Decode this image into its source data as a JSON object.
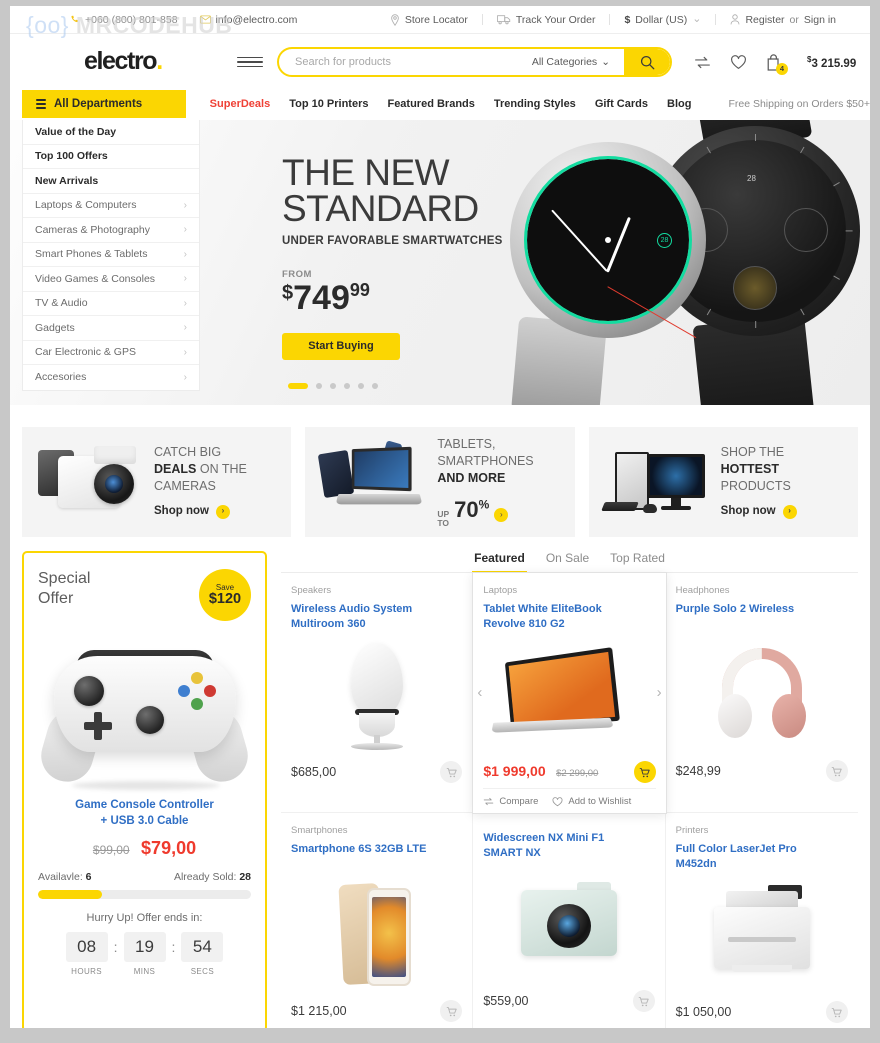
{
  "topbar": {
    "phone": "+060 (800) 801-858",
    "email": "info@electro.com",
    "store_locator": "Store Locator",
    "track_order": "Track Your Order",
    "currency": "Dollar (US)",
    "currency_symbol": "$",
    "register": "Register",
    "or": " or ",
    "signin": "Sign in"
  },
  "header": {
    "watermark_brace_open": "{",
    "watermark_oo": "oo",
    "watermark_brace_close": "}",
    "watermark_text": "MRCODEHUB",
    "logo": "electro",
    "logo_dot": ".",
    "cart_count": "4",
    "cart_total": "3 215.99",
    "cart_currency": "$"
  },
  "search": {
    "placeholder": "Search for products",
    "value": "",
    "category": "All Categories"
  },
  "nav": {
    "all_departments": "All Departments",
    "items": [
      {
        "label": "SuperDeals",
        "highlight": true
      },
      {
        "label": "Top 10 Printers",
        "highlight": false
      },
      {
        "label": "Featured Brands",
        "highlight": false
      },
      {
        "label": "Trending Styles",
        "highlight": false
      },
      {
        "label": "Gift Cards",
        "highlight": false
      },
      {
        "label": "Blog",
        "highlight": false
      }
    ],
    "shipping_note": "Free Shipping on Orders $50+"
  },
  "departments": [
    {
      "label": "Value of the Day",
      "bold": true,
      "arrow": false
    },
    {
      "label": "Top 100 Offers",
      "bold": true,
      "arrow": false
    },
    {
      "label": "New Arrivals",
      "bold": true,
      "arrow": false
    },
    {
      "label": "Laptops & Computers",
      "bold": false,
      "arrow": true
    },
    {
      "label": "Cameras & Photography",
      "bold": false,
      "arrow": true
    },
    {
      "label": "Smart Phones & Tablets",
      "bold": false,
      "arrow": true
    },
    {
      "label": "Video Games & Consoles",
      "bold": false,
      "arrow": true
    },
    {
      "label": "TV & Audio",
      "bold": false,
      "arrow": true
    },
    {
      "label": "Gadgets",
      "bold": false,
      "arrow": true
    },
    {
      "label": "Car Electronic & GPS",
      "bold": false,
      "arrow": true
    },
    {
      "label": "Accesories",
      "bold": false,
      "arrow": true
    }
  ],
  "hero": {
    "title_line1": "THE NEW",
    "title_line2": "STANDARD",
    "subtitle": "UNDER FAVORABLE SMARTWATCHES",
    "from_label": "FROM",
    "currency": "$",
    "price": "749",
    "cents": "99",
    "cta": "Start Buying",
    "watch_num_green": "28",
    "watch_num_dark": "28",
    "slide_count": 6,
    "active_slide": 1
  },
  "promos": [
    {
      "line1": "CATCH BIG",
      "line2_bold": "DEALS",
      "line2_rest": " ON THE",
      "line3": "CAMERAS",
      "cta": "Shop now",
      "art": "camera"
    },
    {
      "line1": "TABLETS,",
      "line2": "SMARTPHONES",
      "line3_bold": "AND MORE",
      "up_to_label1": "UP",
      "up_to_label2": "TO",
      "up_to_value": "70",
      "up_to_unit": "%",
      "art": "laptop-tablet"
    },
    {
      "line1": "SHOP THE",
      "line2_bold": "HOTTEST",
      "line3": "PRODUCTS",
      "cta": "Shop now",
      "art": "desktop"
    }
  ],
  "special_offer": {
    "title_line1": "Special",
    "title_line2": "Offer",
    "save_label": "Save",
    "save_amount": "$120",
    "product_name_line1": "Game Console Controller",
    "product_name_line2": "+ USB 3.0 Cable",
    "old_price": "$99,00",
    "new_price": "$79,00",
    "available_label": "Availavle:",
    "available_value": "6",
    "sold_label": "Already Sold:",
    "sold_value": "28",
    "progress_percent": 30,
    "hurry_text": "Hurry Up! Offer ends in:",
    "countdown": {
      "hours": "08",
      "hours_label": "HOURS",
      "mins": "19",
      "mins_label": "MINS",
      "secs": "54",
      "secs_label": "SECS",
      "separator": ":"
    }
  },
  "product_tabs": [
    {
      "label": "Featured",
      "active": true
    },
    {
      "label": "On Sale",
      "active": false
    },
    {
      "label": "Top Rated",
      "active": false
    }
  ],
  "products": [
    {
      "category": "Speakers",
      "name_line1": "Wireless Audio System",
      "name_line2": "Multiroom 360",
      "price": "$685,00",
      "old_price": "",
      "on_sale": false,
      "hovered": false,
      "art": "speaker"
    },
    {
      "category": "Laptops",
      "name_line1": "Tablet White EliteBook",
      "name_line2": "Revolve 810 G2",
      "price": "$1 999,00",
      "old_price": "$2 299,00",
      "on_sale": true,
      "hovered": true,
      "art": "laptop",
      "compare_label": "Compare",
      "wishlist_label": "Add to Wishlist"
    },
    {
      "category": "Headphones",
      "name_line1": "Purple Solo 2 Wireless",
      "name_line2": "",
      "price": "$248,99",
      "old_price": "",
      "on_sale": false,
      "hovered": false,
      "art": "headphones"
    },
    {
      "category": "Smartphones",
      "name_line1": "Smartphone 6S 32GB LTE",
      "name_line2": "",
      "price": "$1 215,00",
      "old_price": "",
      "on_sale": false,
      "hovered": false,
      "art": "phone"
    },
    {
      "category": "",
      "name_line1": "Widescreen NX Mini F1",
      "name_line2": "SMART NX",
      "price": "$559,00",
      "old_price": "",
      "on_sale": false,
      "hovered": false,
      "art": "compact-camera"
    },
    {
      "category": "Printers",
      "name_line1": "Full Color LaserJet Pro",
      "name_line2": "M452dn",
      "price": "$1 050,00",
      "old_price": "",
      "on_sale": false,
      "hovered": false,
      "art": "printer"
    }
  ],
  "colors": {
    "accent_yellow": "#fbd602",
    "sale_red": "#ef3a2d",
    "link_blue": "#2f6ec4",
    "super_red": "#ef4136",
    "text_dark": "#2b2b2b"
  }
}
